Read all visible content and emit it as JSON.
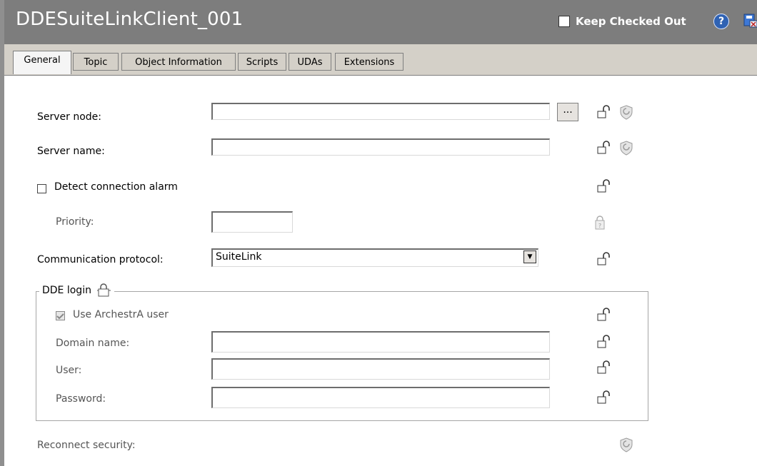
{
  "window": {
    "title": "DDESuiteLinkClient_001",
    "keep_checked_out_label": "Keep Checked Out",
    "keep_checked_out_checked": false,
    "help_icon_glyph": "?"
  },
  "tabs": [
    {
      "label": "General",
      "active": true
    },
    {
      "label": "Topic"
    },
    {
      "label": "Object Information"
    },
    {
      "label": "Scripts"
    },
    {
      "label": "UDAs"
    },
    {
      "label": "Extensions"
    }
  ],
  "form": {
    "server_node_label": "Server node:",
    "server_node_value": "",
    "browse_label": "...",
    "server_name_label": "Server name:",
    "server_name_value": "",
    "detect_alarm_label": "Detect connection alarm",
    "detect_alarm_checked": false,
    "priority_label": "Priority:",
    "priority_value": "",
    "protocol_label": "Communication protocol:",
    "protocol_value": "SuiteLink",
    "dde_login_label": "DDE login",
    "use_archestra_label": "Use ArchestrA user",
    "use_archestra_checked": true,
    "domain_label": "Domain name:",
    "domain_value": "",
    "user_label": "User:",
    "user_value": "",
    "password_label": "Password:",
    "password_value": "",
    "reconnect_label": "Reconnect security:"
  },
  "icons": {
    "lock": "lock-icon",
    "lock_question": "lock-question-icon",
    "shield": "security-shield-icon",
    "help": "help-icon",
    "dde_login_lock": "group-lock-icon"
  },
  "colors": {
    "titlebar": "#7d7d7d",
    "tabstrip": "#d4d0c8"
  }
}
